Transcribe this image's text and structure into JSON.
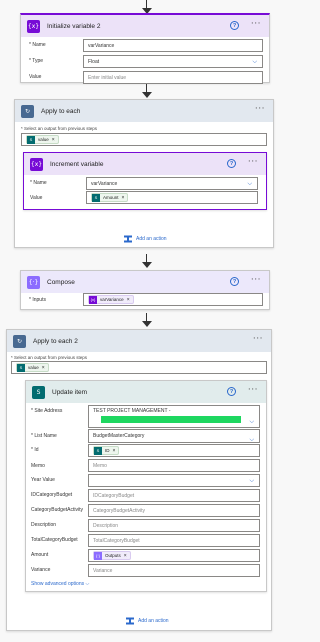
{
  "colors": {
    "variable_purple": "#770bd6",
    "variable_head_bg": "#ece2f8",
    "compose_head_bg": "#ece8fb",
    "compose_purple": "#8c6cff",
    "loop_head_bg": "#e2e8ef",
    "loop_icon": "#486991",
    "sharepoint_head_bg": "#e1ecec",
    "sharepoint_icon": "#036c70",
    "link_blue": "#2b69cc",
    "site_bar_green": "#1ed760"
  },
  "init_var": {
    "title": "Initialize variable 2",
    "icon": "variable-icon",
    "name_label": "* Name",
    "name_value": "varVariance",
    "type_label": "* Type",
    "type_value": "Float",
    "value_label": "Value",
    "value_placeholder": "Enter initial value"
  },
  "apply1": {
    "title": "Apply to each",
    "icon": "loop-icon",
    "hint": "* Select an output from previous steps",
    "token": "value",
    "increment": {
      "title": "Increment variable",
      "name_label": "* Name",
      "name_value": "varVariance",
      "value_label": "Value",
      "value_token": "Amount"
    },
    "add_action": "Add an action"
  },
  "compose": {
    "title": "Compose",
    "icon": "compose-icon",
    "inputs_label": "* Inputs",
    "inputs_token": "varVariance"
  },
  "apply2": {
    "title": "Apply to each 2",
    "icon": "loop-icon",
    "hint": "* Select an output from previous steps",
    "token": "value",
    "update": {
      "title": "Update item",
      "icon": "sharepoint-icon",
      "site_label": "* Site Address",
      "site_value": "TEST PROJECT MANAGEMENT -",
      "list_label": "* List Name",
      "list_value": "BudgetMasterCategory",
      "id_label": "* Id",
      "id_token": "ID",
      "memo_label": "Memo",
      "memo_placeholder": "Memo",
      "year_label": "Year Value",
      "idcat_label": "IDCategoryBudget",
      "idcat_placeholder": "IDCategoryBudget",
      "catact_label": "CategoryBudgetActivity",
      "catact_placeholder": "CategoryBudgetActivity",
      "desc_label": "Description",
      "desc_placeholder": "Description",
      "total_label": "TotalCategoryBudget",
      "total_placeholder": "TotalCategoryBudget",
      "amount_label": "Amount",
      "amount_token": "Outputs",
      "variance_label": "Variance",
      "variance_placeholder": "Variance",
      "show_advanced": "Show advanced options"
    },
    "add_action": "Add an action"
  }
}
